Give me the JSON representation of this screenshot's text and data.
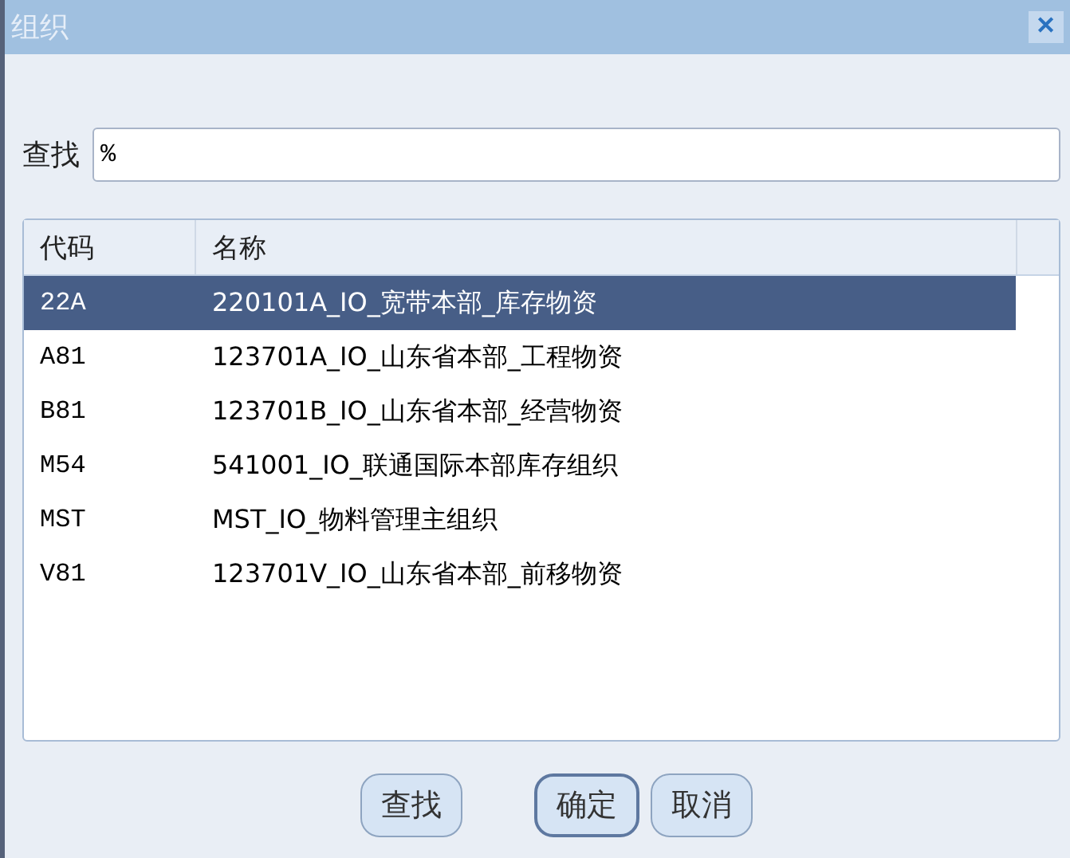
{
  "window": {
    "title": "组织",
    "close": "✕"
  },
  "search": {
    "label": "查找",
    "value": "%"
  },
  "table": {
    "columns": [
      "代码",
      "名称"
    ],
    "rows": [
      {
        "code": "22A",
        "name": "220101A_IO_宽带本部_库存物资",
        "selected": true
      },
      {
        "code": "A81",
        "name": "123701A_IO_山东省本部_工程物资",
        "selected": false
      },
      {
        "code": "B81",
        "name": "123701B_IO_山东省本部_经营物资",
        "selected": false
      },
      {
        "code": "M54",
        "name": "541001_IO_联通国际本部库存组织",
        "selected": false
      },
      {
        "code": "MST",
        "name": "MST_IO_物料管理主组织",
        "selected": false
      },
      {
        "code": "V81",
        "name": "123701V_IO_山东省本部_前移物资",
        "selected": false
      }
    ]
  },
  "buttons": [
    {
      "label": "查找",
      "default": false
    },
    {
      "label": "确定",
      "default": true
    },
    {
      "label": "取消",
      "default": false
    }
  ]
}
